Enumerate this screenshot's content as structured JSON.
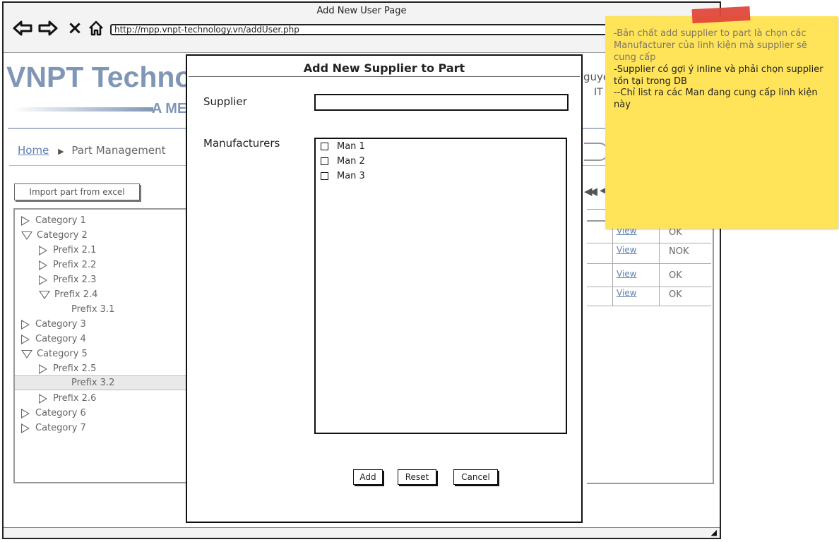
{
  "window": {
    "title": "Add New User Page",
    "url": "http://mpp.vnpt-technology.vn/addUser.php"
  },
  "background": {
    "brand": "VNPT Techno",
    "brand_sub": "A ME",
    "user_partial": "guye",
    "user_role_partial": "IT",
    "breadcrumb": {
      "home": "Home",
      "current": "Part Management"
    },
    "import_button": "Import part from excel",
    "tree": [
      {
        "label": "Category 1",
        "icon": "expand-right"
      },
      {
        "label": "Category 2",
        "icon": "expand-down"
      },
      {
        "label": "Prefix 2.1",
        "icon": "expand-right"
      },
      {
        "label": "Prefix 2.2",
        "icon": "expand-right"
      },
      {
        "label": "Prefix 2.3",
        "icon": "expand-right"
      },
      {
        "label": "Prefix 2.4",
        "icon": "expand-down"
      },
      {
        "label": "Prefix 3.1",
        "icon": "none"
      },
      {
        "label": "Category 3",
        "icon": "expand-right"
      },
      {
        "label": "Category 4",
        "icon": "expand-right"
      },
      {
        "label": "Category 5",
        "icon": "expand-down"
      },
      {
        "label": "Prefix 2.5",
        "icon": "expand-right"
      },
      {
        "label": "Prefix 3.2",
        "icon": "none",
        "selected": true
      },
      {
        "label": "Prefix 2.6",
        "icon": "expand-right"
      },
      {
        "label": "Category 6",
        "icon": "expand-right"
      },
      {
        "label": "Category 7",
        "icon": "expand-right"
      }
    ],
    "table_rows": [
      {
        "link": "View",
        "status": "OK"
      },
      {
        "link": "View",
        "status": "NOK"
      },
      {
        "link": "View",
        "status": "OK"
      },
      {
        "link": "View",
        "status": "OK"
      }
    ]
  },
  "modal": {
    "title": "Add New Supplier to Part",
    "supplier_label": "Supplier",
    "supplier_value": "",
    "manufacturers_label": "Manufacturers",
    "manufacturers": [
      "Man 1",
      "Man 2",
      "Man 3"
    ],
    "buttons": {
      "add": "Add",
      "reset": "Reset",
      "cancel": "Cancel"
    }
  },
  "sticky_note": {
    "lines": [
      "-Bản chất add supplier to part là chọn các Manufacturer của linh kiện mà supplier sẽ cung cấp",
      "-Supplier có gợi ý inline và phải chọn supplier tồn tại trong DB",
      "--Chỉ list ra các Man đang cung cấp linh kiện này"
    ],
    "colors": {
      "note": "#ffe45a",
      "tape": "#e0483b"
    }
  }
}
